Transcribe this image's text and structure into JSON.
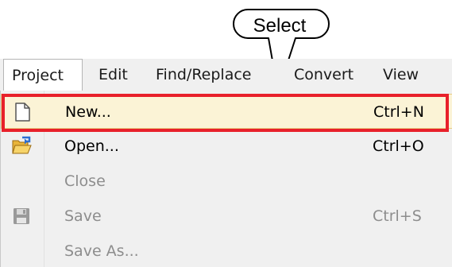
{
  "callout": {
    "text": "Select"
  },
  "menubar": {
    "items": [
      {
        "label": "Project"
      },
      {
        "label": "Edit"
      },
      {
        "label": "Find/Replace"
      },
      {
        "label": "Convert"
      },
      {
        "label": "View"
      }
    ]
  },
  "menu": {
    "items": [
      {
        "label": "New...",
        "shortcut": "Ctrl+N",
        "icon": "new-document-icon",
        "enabled": true,
        "highlighted": true
      },
      {
        "label": "Open...",
        "shortcut": "Ctrl+O",
        "icon": "open-folder-icon",
        "enabled": true
      },
      {
        "label": "Close",
        "shortcut": "",
        "enabled": false
      },
      {
        "label": "Save",
        "shortcut": "Ctrl+S",
        "icon": "save-disk-icon",
        "enabled": false
      },
      {
        "label": "Save As...",
        "shortcut": "",
        "enabled": false
      }
    ]
  },
  "colors": {
    "highlight_box": "#e8202a",
    "hover_fill": "#fbf3d6",
    "menu_background": "#f0f0f0"
  }
}
